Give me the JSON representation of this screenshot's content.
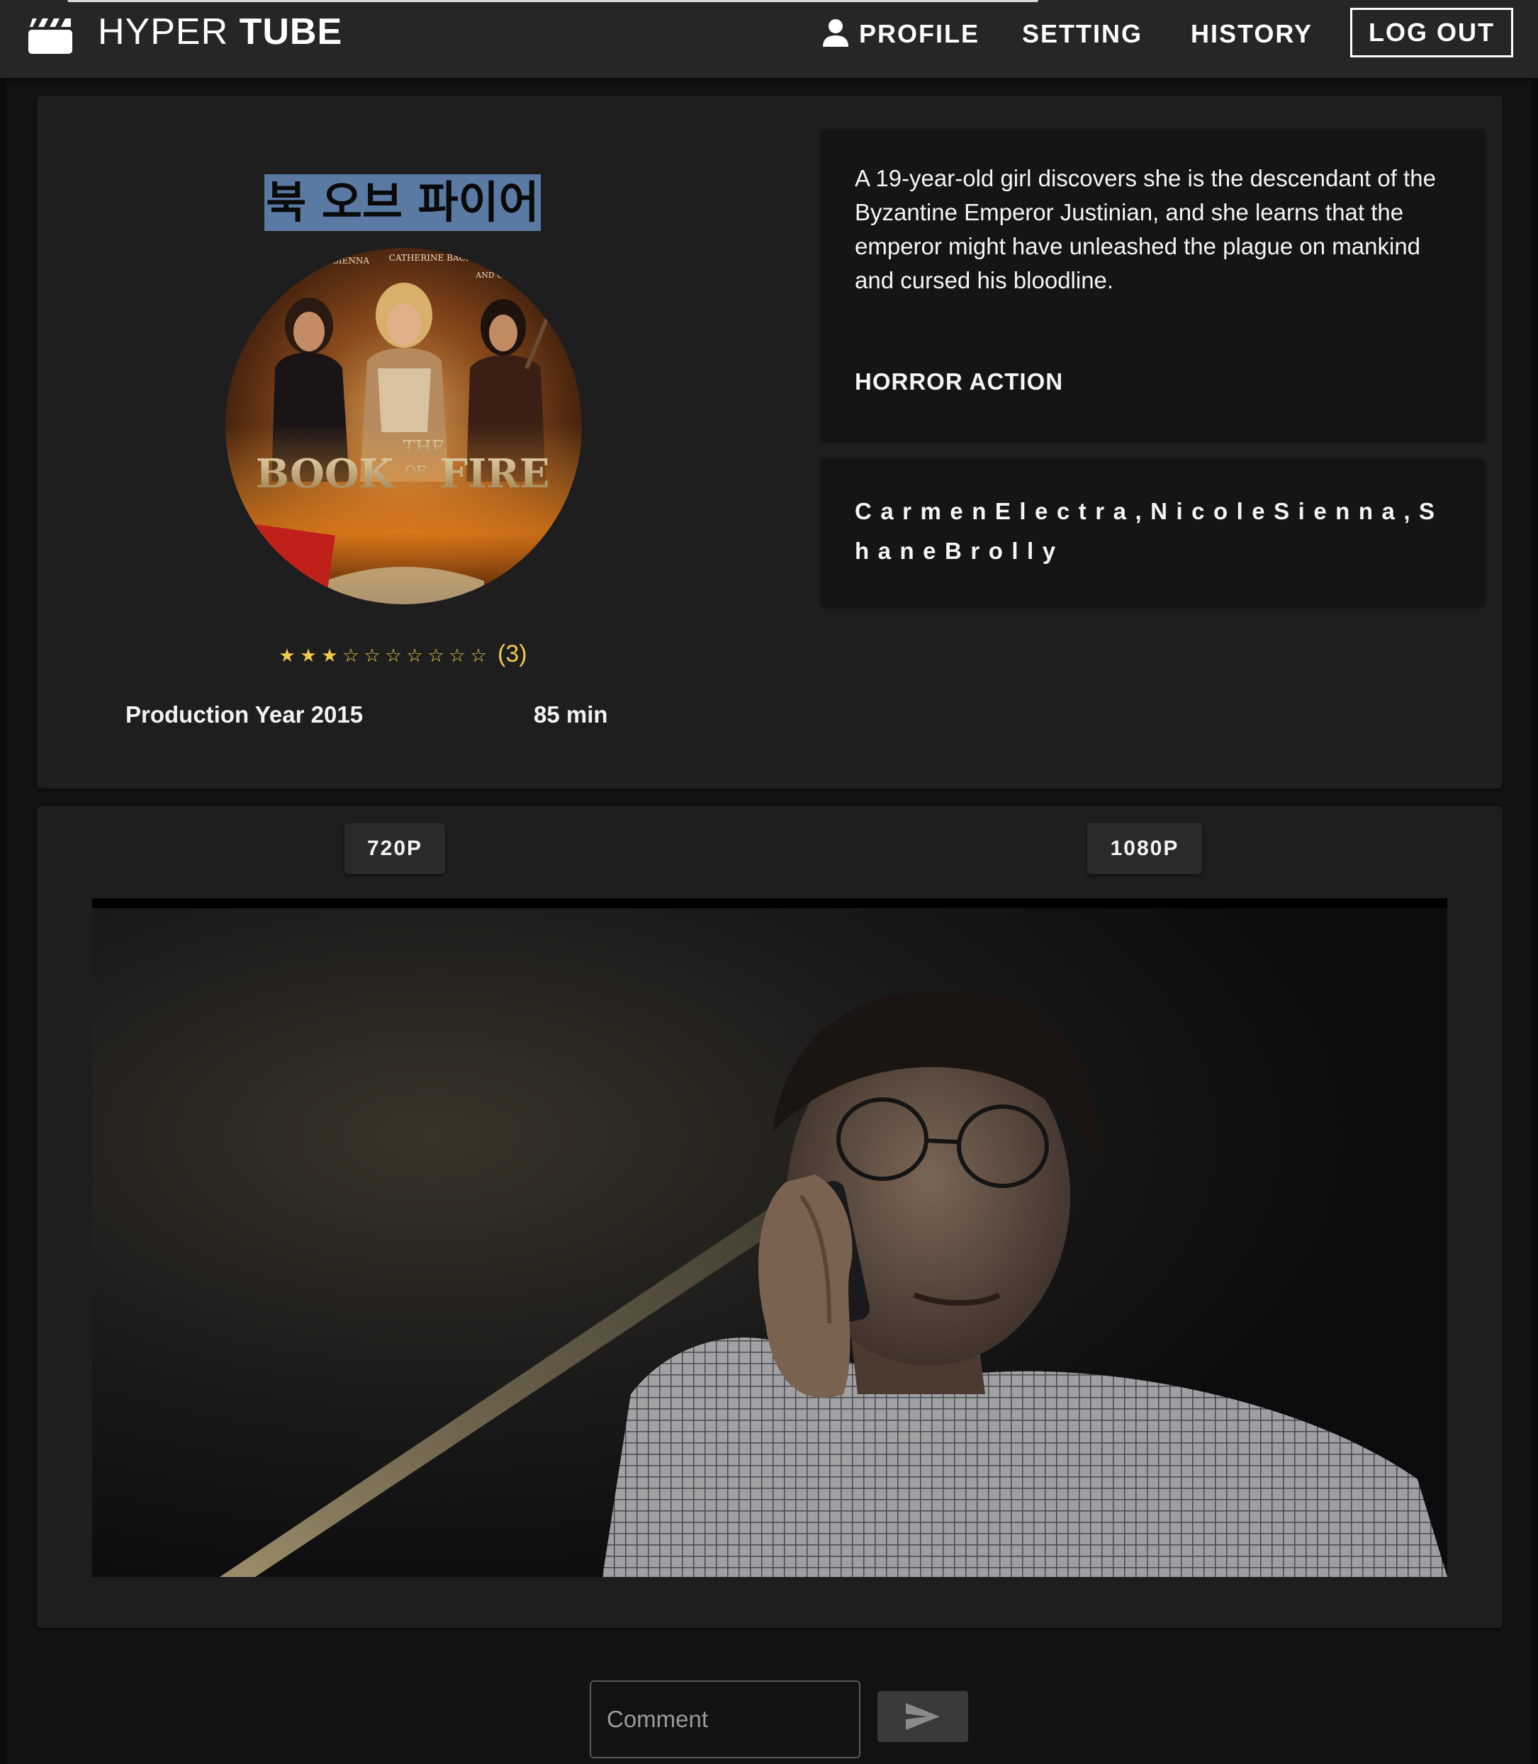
{
  "header": {
    "brand_light": "HYPER",
    "brand_bold": "TUBE",
    "nav": {
      "profile": "PROFILE",
      "setting": "SETTING",
      "history": "HISTORY",
      "logout": "LOG OUT"
    }
  },
  "movie": {
    "title": "북 오브 파이어",
    "poster_text": {
      "title_top": "THE",
      "title_main": "BOOK",
      "title_of": "OF",
      "title_end": "FIRE",
      "credit_1": "NICOLE SIENNA",
      "credit_2": "CATHERINE BACH",
      "credit_3": "AND CARMEN"
    },
    "rating": {
      "filled": 3,
      "max": 10,
      "star_filled": "★",
      "star_empty": "☆",
      "count_label": "(3)"
    },
    "production_year_label": "Production Year 2015",
    "runtime_label": "85 min",
    "synopsis": "A 19-year-old girl discovers she is the descendant of the Byzantine Emperor Justinian, and she learns that the emperor might have unleashed the plague on mankind and cursed his bloodline.",
    "genres": "HORROR ACTION",
    "cast": "CarmenElectra,NicoleSienna,ShaneBrolly"
  },
  "player": {
    "quality_options": [
      "720P",
      "1080P"
    ]
  },
  "comment": {
    "placeholder": "Comment",
    "value": ""
  },
  "colors": {
    "star": "#f2c94c",
    "title_highlight": "#5b7aa3",
    "header_bg": "#262627",
    "card_bg": "#1e1e1f",
    "page_bg": "#121212"
  },
  "icons": {
    "logo": "clapperboard-icon",
    "profile": "person-icon",
    "send": "send-icon"
  }
}
